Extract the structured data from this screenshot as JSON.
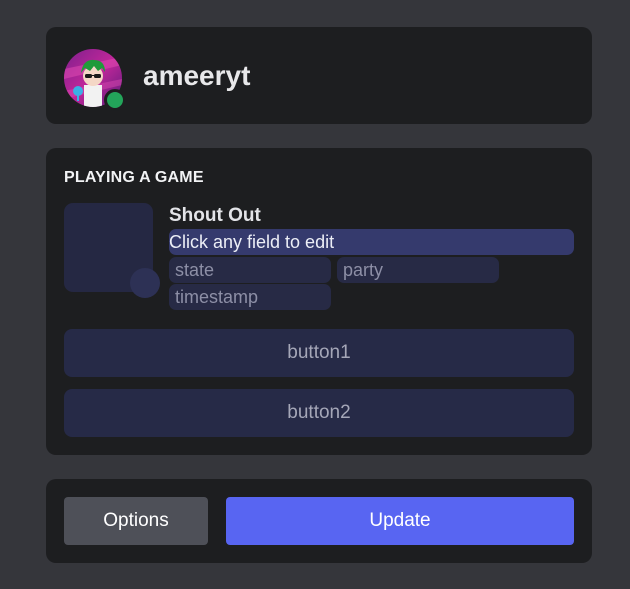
{
  "profile": {
    "username": "ameeryt",
    "status_color": "#23a55a"
  },
  "activity": {
    "heading": "PLAYING A GAME",
    "name": "Shout Out",
    "details": "Click any field to edit",
    "state_placeholder": "state",
    "party_placeholder": "party",
    "timestamp_placeholder": "timestamp",
    "button1_label": "button1",
    "button2_label": "button2"
  },
  "actions": {
    "options_label": "Options",
    "update_label": "Update"
  },
  "colors": {
    "accent": "#5865f2",
    "background": "#35363b",
    "card": "#1d1e20"
  }
}
